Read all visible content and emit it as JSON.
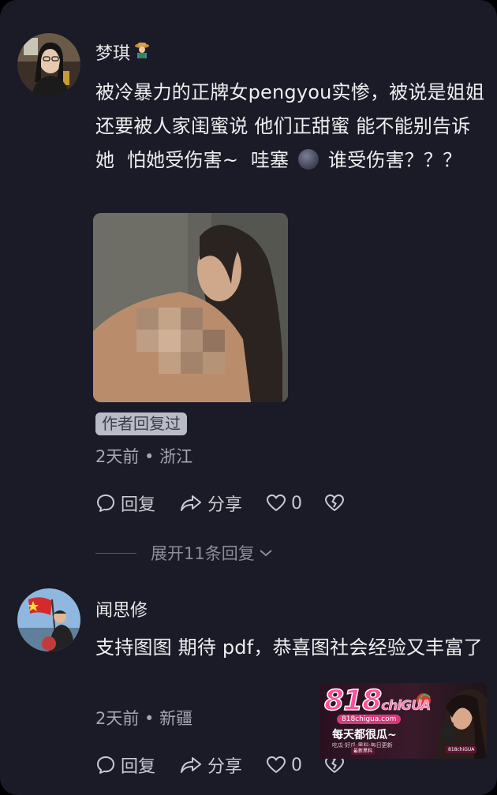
{
  "comments": [
    {
      "username": "梦琪",
      "user_emoji": "farmer-emoji",
      "text_before_emoji": "被冷暴力的正牌女pengyou实惨，被说是姐姐 还要被人家闺蜜说 他们正甜蜜 能不能别告诉她  怕她受伤害~  哇塞 ",
      "text_after_emoji": " 谁受伤害？？？",
      "inline_emoji": "dark-moon-emoji",
      "has_image": true,
      "author_tag": "作者回复过",
      "time": "2天前",
      "location": "浙江",
      "reply_label": "回复",
      "share_label": "分享",
      "like_count": "0",
      "expand_label": "展开11条回复"
    },
    {
      "username": "闻思修",
      "text": "支持图图 期待 pdf，恭喜图社会经验又丰富了",
      "time": "2天前",
      "location": "新疆",
      "reply_label": "回复",
      "share_label": "分享",
      "like_count": "0"
    }
  ],
  "watermark": {
    "logo_main": "818",
    "logo_sub": "chiGUA",
    "url": "818chigua.com",
    "slogan": "每天都很瓜~",
    "sub": "吃瓜·好瓜·黑料·每日更新",
    "badge_left": "最新黑料",
    "badge_right": "818chiGUA"
  },
  "colors": {
    "background": "#1a1b27",
    "text": "#efefef",
    "muted": "#a5a7b2",
    "tag_bg": "#b9bbc5"
  },
  "icons": {
    "reply": "comment-bubble-icon",
    "share": "share-arrow-icon",
    "like": "heart-icon",
    "dislike": "broken-heart-icon",
    "expand": "chevron-down-icon"
  }
}
